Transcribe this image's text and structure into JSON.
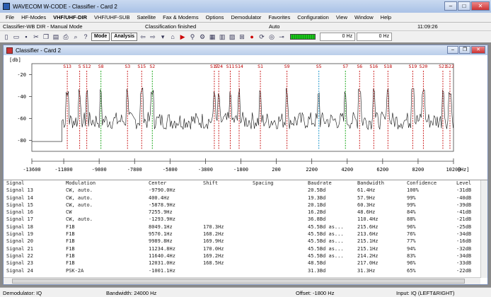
{
  "app": {
    "title": "WAVECOM W-CODE - Classifier - Card 2"
  },
  "menu": [
    "File",
    "HF-Modes",
    "VHF/UHF-DIR",
    "VHF/UHF-SUB",
    "Satellite",
    "Fax & Modems",
    "Options",
    "Demodulator",
    "Favorites",
    "Configuration",
    "View",
    "Window",
    "Help"
  ],
  "status_top": {
    "mode": "Classifier-WB DIR - Manual Mode",
    "state": "Classification finished",
    "auto": "Auto",
    "time": "11:09:26"
  },
  "toolbar": {
    "mode_label": "Mode",
    "analysis_label": "Analysis",
    "hz1": "0 Hz",
    "hz2": "0 Hz"
  },
  "child": {
    "title": "Classifier - Card 2"
  },
  "chart_data": {
    "type": "line",
    "ylabel": "[db]",
    "xlabel": "[Hz]",
    "ylim": [
      -90,
      -10
    ],
    "xlim": [
      -13600,
      10200
    ],
    "y_ticks": [
      "-20",
      "-40",
      "-60",
      "-80"
    ],
    "x_ticks": [
      "-13600",
      "-11800",
      "-9800",
      "-7800",
      "-5800",
      "-3800",
      "-1800",
      "200",
      "2200",
      "4200",
      "6200",
      "8200",
      "10200"
    ],
    "markers": [
      {
        "label": "S13",
        "x": -11600,
        "color": "#c22"
      },
      {
        "label": "S",
        "x": -10900,
        "color": "#c22"
      },
      {
        "label": "S12",
        "x": -10500,
        "color": "#c22"
      },
      {
        "label": "S8",
        "x": -9700,
        "color": "#2a2"
      },
      {
        "label": "S3",
        "x": -8200,
        "color": "#c22"
      },
      {
        "label": "S15",
        "x": -7400,
        "color": "#c22"
      },
      {
        "label": "S2",
        "x": -6800,
        "color": "#2a2"
      },
      {
        "label": "S17",
        "x": -3300,
        "color": "#c22"
      },
      {
        "label": "S24",
        "x": -3050,
        "color": "#c22"
      },
      {
        "label": "S11",
        "x": -2400,
        "color": "#c22"
      },
      {
        "label": "S14",
        "x": -1900,
        "color": "#c22"
      },
      {
        "label": "S1",
        "x": -700,
        "color": "#c22"
      },
      {
        "label": "S9",
        "x": 800,
        "color": "#c22"
      },
      {
        "label": "S5",
        "x": 2600,
        "color": "#29c"
      },
      {
        "label": "S7",
        "x": 4100,
        "color": "#2a2"
      },
      {
        "label": "S6",
        "x": 4900,
        "color": "#c22"
      },
      {
        "label": "S16",
        "x": 5700,
        "color": "#c22"
      },
      {
        "label": "S18",
        "x": 6500,
        "color": "#c22"
      },
      {
        "label": "S19",
        "x": 7900,
        "color": "#c22"
      },
      {
        "label": "S20",
        "x": 8500,
        "color": "#c22"
      },
      {
        "label": "S21",
        "x": 9600,
        "color": "#c22"
      },
      {
        "label": "S22",
        "x": 10000,
        "color": "#c22"
      }
    ]
  },
  "table": {
    "headers": [
      "Signal",
      "Modulation",
      "Center",
      "Shift",
      "Spacing",
      "Baudrate",
      "Bandwidth",
      "Confidence",
      "Level"
    ],
    "rows": [
      [
        "Signal 13",
        "CW, auto.",
        "-9790.0Hz",
        "",
        "",
        "20.5Bd",
        "61.4Hz",
        "100%",
        "-31dB"
      ],
      [
        "Signal 14",
        "CW, auto.",
        "400.4Hz",
        "",
        "",
        "19.3Bd",
        "57.9Hz",
        "99%",
        "-40dB"
      ],
      [
        "Signal 15",
        "CW, auto.",
        "-5878.9Hz",
        "",
        "",
        "20.1Bd",
        "60.3Hz",
        "99%",
        "-39dB"
      ],
      [
        "Signal 16",
        "CW",
        "7255.9Hz",
        "",
        "",
        "16.2Bd",
        "48.6Hz",
        "84%",
        "-41dB"
      ],
      [
        "Signal 17",
        "CW, auto.",
        "-1293.9Hz",
        "",
        "",
        "36.8Bd",
        "110.4Hz",
        "88%",
        "-21dB"
      ],
      [
        "Signal 18",
        "F1B",
        "8049.1Hz",
        "170.3Hz",
        "",
        "45.5Bd as...",
        "215.6Hz",
        "96%",
        "-25dB"
      ],
      [
        "Signal 19",
        "F1B",
        "9570.1Hz",
        "168.2Hz",
        "",
        "45.5Bd as...",
        "213.6Hz",
        "76%",
        "-34dB"
      ],
      [
        "Signal 20",
        "F1B",
        "9989.8Hz",
        "169.9Hz",
        "",
        "45.5Bd as...",
        "215.1Hz",
        "77%",
        "-16dB"
      ],
      [
        "Signal 21",
        "F1B",
        "11234.8Hz",
        "170.0Hz",
        "",
        "45.5Bd as...",
        "215.1Hz",
        "94%",
        "-32dB"
      ],
      [
        "Signal 22",
        "F1B",
        "11640.4Hz",
        "169.2Hz",
        "",
        "45.5Bd as...",
        "214.2Hz",
        "83%",
        "-34dB"
      ],
      [
        "Signal 23",
        "F1B",
        "12031.0Hz",
        "168.5Hz",
        "",
        "48.5Bd",
        "217.0Hz",
        "96%",
        "-33dB"
      ],
      [
        "Signal 24",
        "PSK-2A",
        "-1001.1Hz",
        "",
        "",
        "31.3Bd",
        "31.3Hz",
        "65%",
        "-22dB"
      ]
    ]
  },
  "statusbar": {
    "demod": "Demodulator: IQ",
    "bandwidth": "Bandwidth: 24000 Hz",
    "offset": "Offset: -1800 Hz",
    "input": "Input: IQ (LEFT&RIGHT)"
  }
}
